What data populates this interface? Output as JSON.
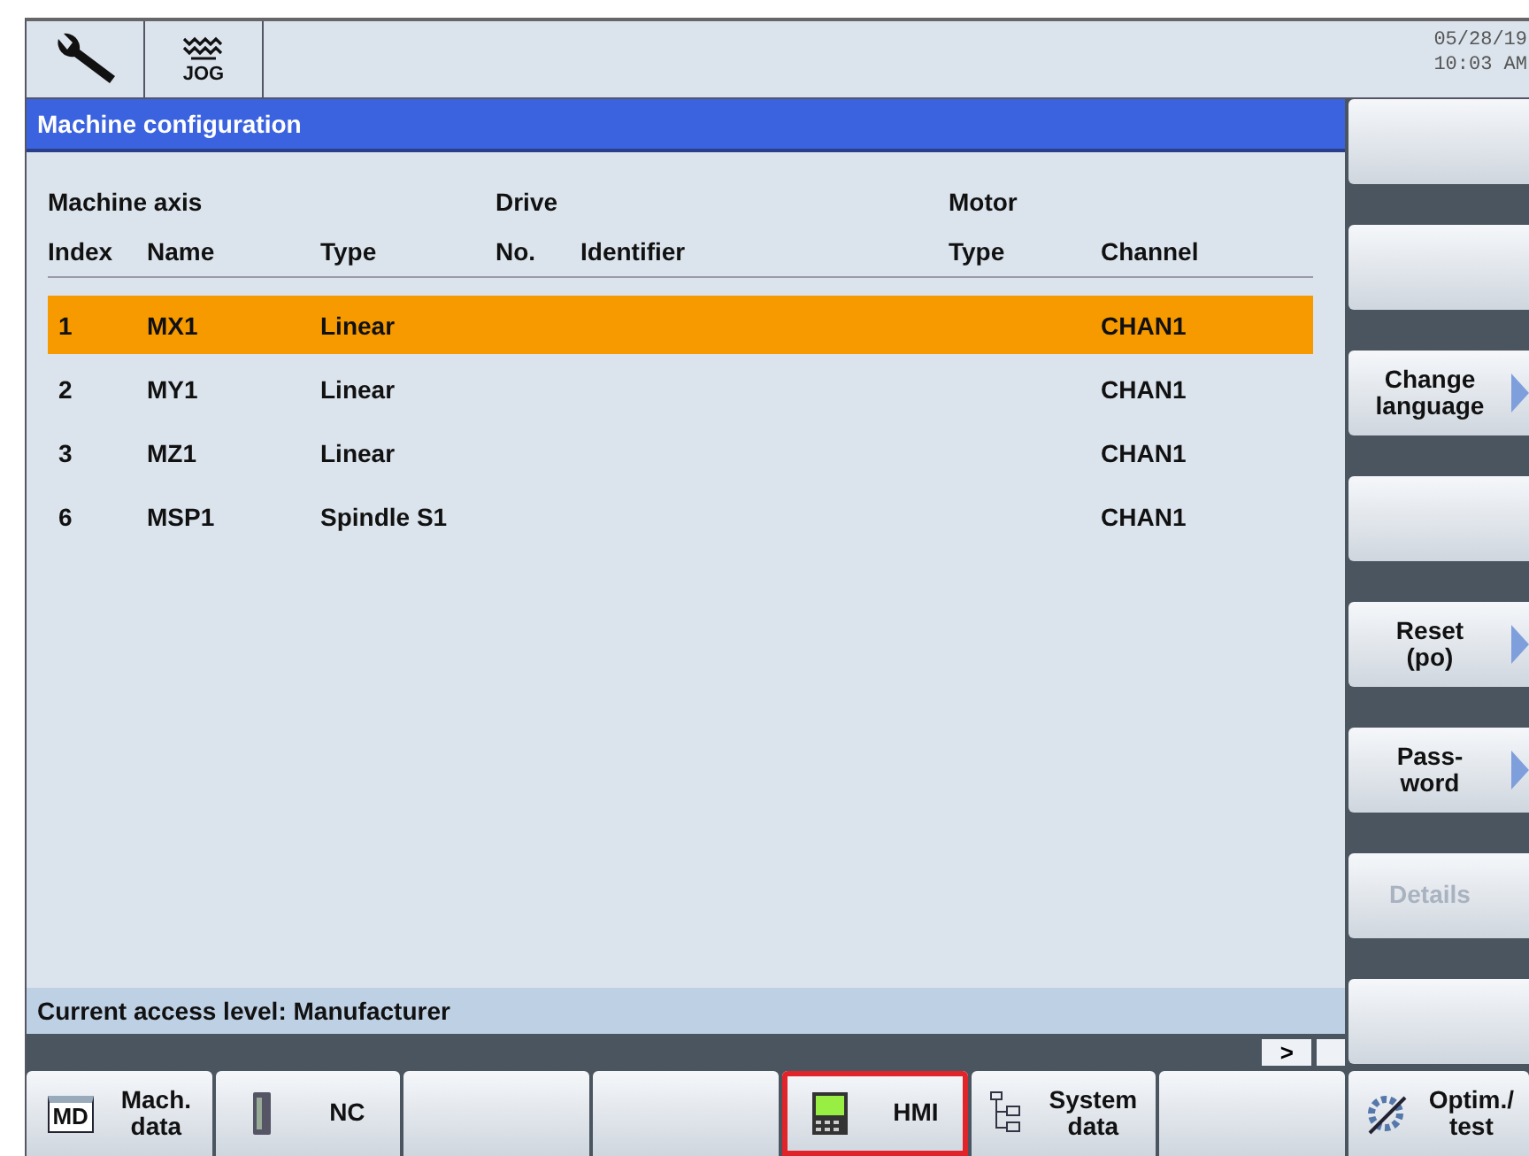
{
  "header": {
    "mode": "JOG",
    "date": "05/28/19",
    "time": "10:03 AM"
  },
  "window": {
    "title": "Machine configuration"
  },
  "table": {
    "groups": [
      "Machine axis",
      "Drive",
      "Motor"
    ],
    "columns": [
      "Index",
      "Name",
      "Type",
      "No.",
      "Identifier",
      "Type",
      "Channel"
    ],
    "rows": [
      {
        "cells": [
          "1",
          "MX1",
          "Linear",
          "",
          "",
          "",
          "CHAN1"
        ],
        "selected": true
      },
      {
        "cells": [
          "2",
          "MY1",
          "Linear",
          "",
          "",
          "",
          "CHAN1"
        ],
        "selected": false
      },
      {
        "cells": [
          "3",
          "MZ1",
          "Linear",
          "",
          "",
          "",
          "CHAN1"
        ],
        "selected": false
      },
      {
        "cells": [
          "6",
          "MSP1",
          "Spindle S1",
          "",
          "",
          "",
          "CHAN1"
        ],
        "selected": false
      }
    ]
  },
  "status_bar": {
    "text": "Current access level: Manufacturer",
    "scroll_button": ">"
  },
  "vertical_softkeys": [
    {
      "arrow": false
    },
    {
      "arrow": false
    },
    {
      "label": "Change\nlanguage",
      "arrow": true,
      "disabled": false
    },
    {
      "arrow": false
    },
    {
      "label": "Reset\n(po)",
      "arrow": true,
      "disabled": false
    },
    {
      "label": "Pass-\nword",
      "arrow": true,
      "disabled": false
    },
    {
      "label": "Details",
      "arrow": false,
      "disabled": true
    },
    {
      "arrow": false
    }
  ],
  "horizontal_softkeys": [
    {
      "label": "Mach.\ndata",
      "kind": "md",
      "icon_text": "MD",
      "selected": false
    },
    {
      "label": "NC",
      "kind": "drive",
      "selected": false
    },
    {
      "kind": "blank",
      "selected": false
    },
    {
      "kind": "blank",
      "selected": false
    },
    {
      "label": "HMI",
      "kind": "panel",
      "selected": true
    },
    {
      "label": "System\ndata",
      "kind": "tree",
      "selected": false
    },
    {
      "kind": "blank",
      "selected": false
    },
    {
      "label": "Optim./\ntest",
      "kind": "scope",
      "selected": false
    }
  ]
}
